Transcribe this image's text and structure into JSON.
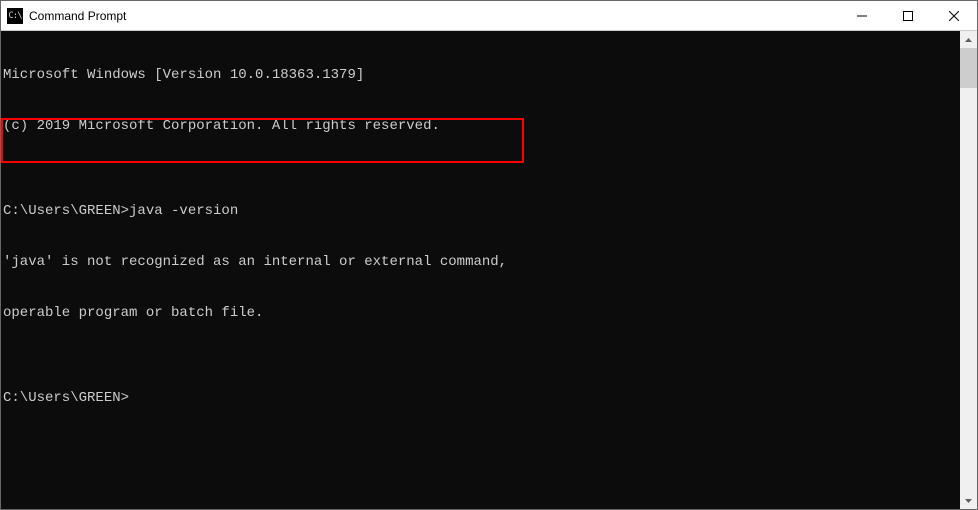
{
  "window": {
    "title": "Command Prompt",
    "icon_text": "C:\\"
  },
  "terminal": {
    "lines": [
      "Microsoft Windows [Version 10.0.18363.1379]",
      "(c) 2019 Microsoft Corporation. All rights reserved.",
      "",
      "C:\\Users\\GREEN>java -version",
      "'java' is not recognized as an internal or external command,",
      "operable program or batch file.",
      "",
      "C:\\Users\\GREEN>"
    ]
  }
}
